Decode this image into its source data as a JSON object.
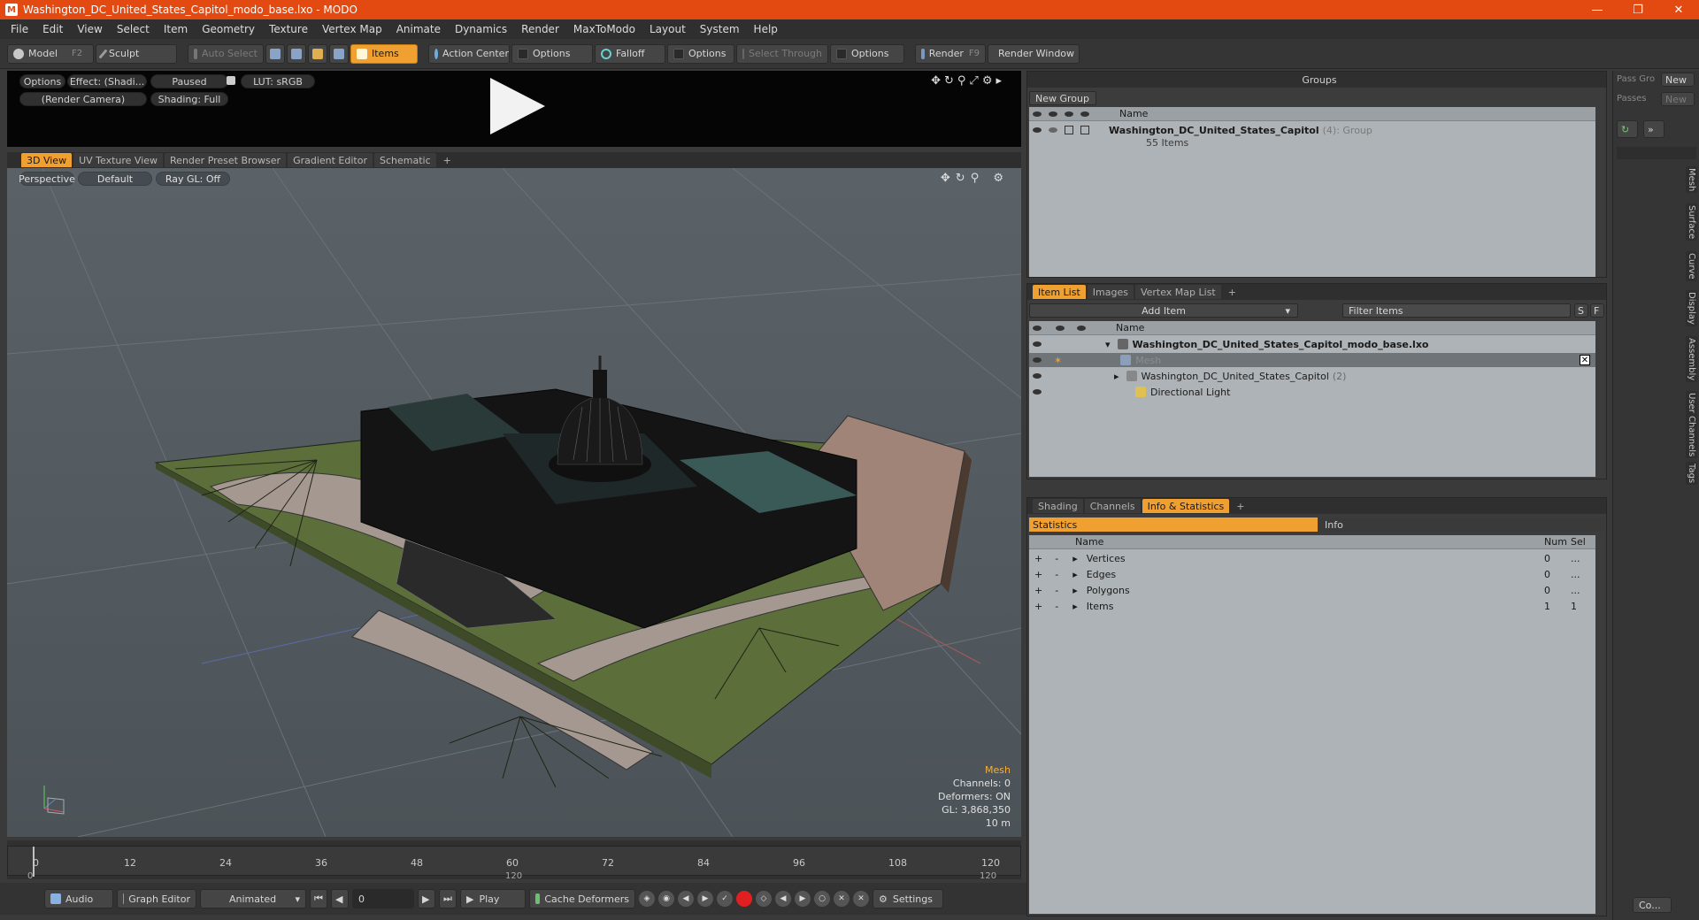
{
  "window": {
    "title": "Washington_DC_United_States_Capitol_modo_base.lxo - MODO",
    "app_icon": "modo-icon"
  },
  "menu": [
    "File",
    "Edit",
    "View",
    "Select",
    "Item",
    "Geometry",
    "Texture",
    "Vertex Map",
    "Animate",
    "Dynamics",
    "Render",
    "MaxToModo",
    "Layout",
    "System",
    "Help"
  ],
  "toolbar": {
    "model": "Model",
    "model_key": "F2",
    "sculpt": "Sculpt",
    "auto_select": "Auto Select",
    "items": "Items",
    "action_center": "Action Center",
    "options1": "Options",
    "falloff": "Falloff",
    "options2": "Options",
    "select_through": "Select Through",
    "options3": "Options",
    "render": "Render",
    "render_key": "F9",
    "render_window": "Render Window"
  },
  "preview": {
    "options": "Options",
    "effect": "Effect: (Shadi...",
    "paused": "Paused",
    "lut": "LUT: sRGB",
    "camera": "(Render Camera)",
    "shading": "Shading: Full"
  },
  "viewport_tabs": [
    "3D View",
    "UV Texture View",
    "Render Preset Browser",
    "Gradient Editor",
    "Schematic",
    "+"
  ],
  "viewport": {
    "perspective": "Perspective",
    "default": "Default",
    "raygl": "Ray GL: Off",
    "stats": {
      "mesh": "Mesh",
      "channels": "Channels: 0",
      "deformers": "Deformers: ON",
      "gl": "GL: 3,868,350",
      "scale": "10 m"
    }
  },
  "timeline": {
    "ticks": [
      "0",
      "12",
      "24",
      "36",
      "48",
      "60",
      "72",
      "84",
      "96",
      "108",
      "120"
    ],
    "range_start": "0",
    "range_mid": "120",
    "range_end": "120"
  },
  "bottom": {
    "audio": "Audio",
    "graph_editor": "Graph Editor",
    "animated": "Animated",
    "frame": "0",
    "play": "Play",
    "cache": "Cache Deformers",
    "settings": "Settings"
  },
  "groups": {
    "title": "Groups",
    "new_group": "New Group",
    "col_name": "Name",
    "item_name": "Washington_DC_United_States_Capitol",
    "item_count": "(4)",
    "item_type": ": Group",
    "item_sub": "55 Items"
  },
  "passes": {
    "pass_group": "Pass Gro",
    "new1": "New",
    "passes": "Passes",
    "new2": "New"
  },
  "item_list": {
    "tabs": [
      "Item List",
      "Images",
      "Vertex Map List",
      "+"
    ],
    "add_item": "Add Item",
    "filter": "Filter Items",
    "col_name": "Name",
    "root": "Washington_DC_United_States_Capitol_modo_base.lxo",
    "mesh": "Mesh",
    "group": "Washington_DC_United_States_Capitol",
    "group_count": "(2)",
    "light": "Directional Light"
  },
  "stats_panel": {
    "tabs": [
      "Shading",
      "Channels",
      "Info & Statistics",
      "+"
    ],
    "statistics": "Statistics",
    "info": "Info",
    "cols": {
      "name": "Name",
      "num": "Num",
      "sel": "Sel"
    },
    "rows": [
      {
        "name": "Vertices",
        "num": "0",
        "sel": "..."
      },
      {
        "name": "Edges",
        "num": "0",
        "sel": "..."
      },
      {
        "name": "Polygons",
        "num": "0",
        "sel": "..."
      },
      {
        "name": "Items",
        "num": "1",
        "sel": "1"
      }
    ]
  },
  "side_tabs": [
    "Mesh",
    "Surface",
    "Curve",
    "Display",
    "Assembly",
    "User Channels",
    "Tags"
  ],
  "side_bottom": "Co..."
}
